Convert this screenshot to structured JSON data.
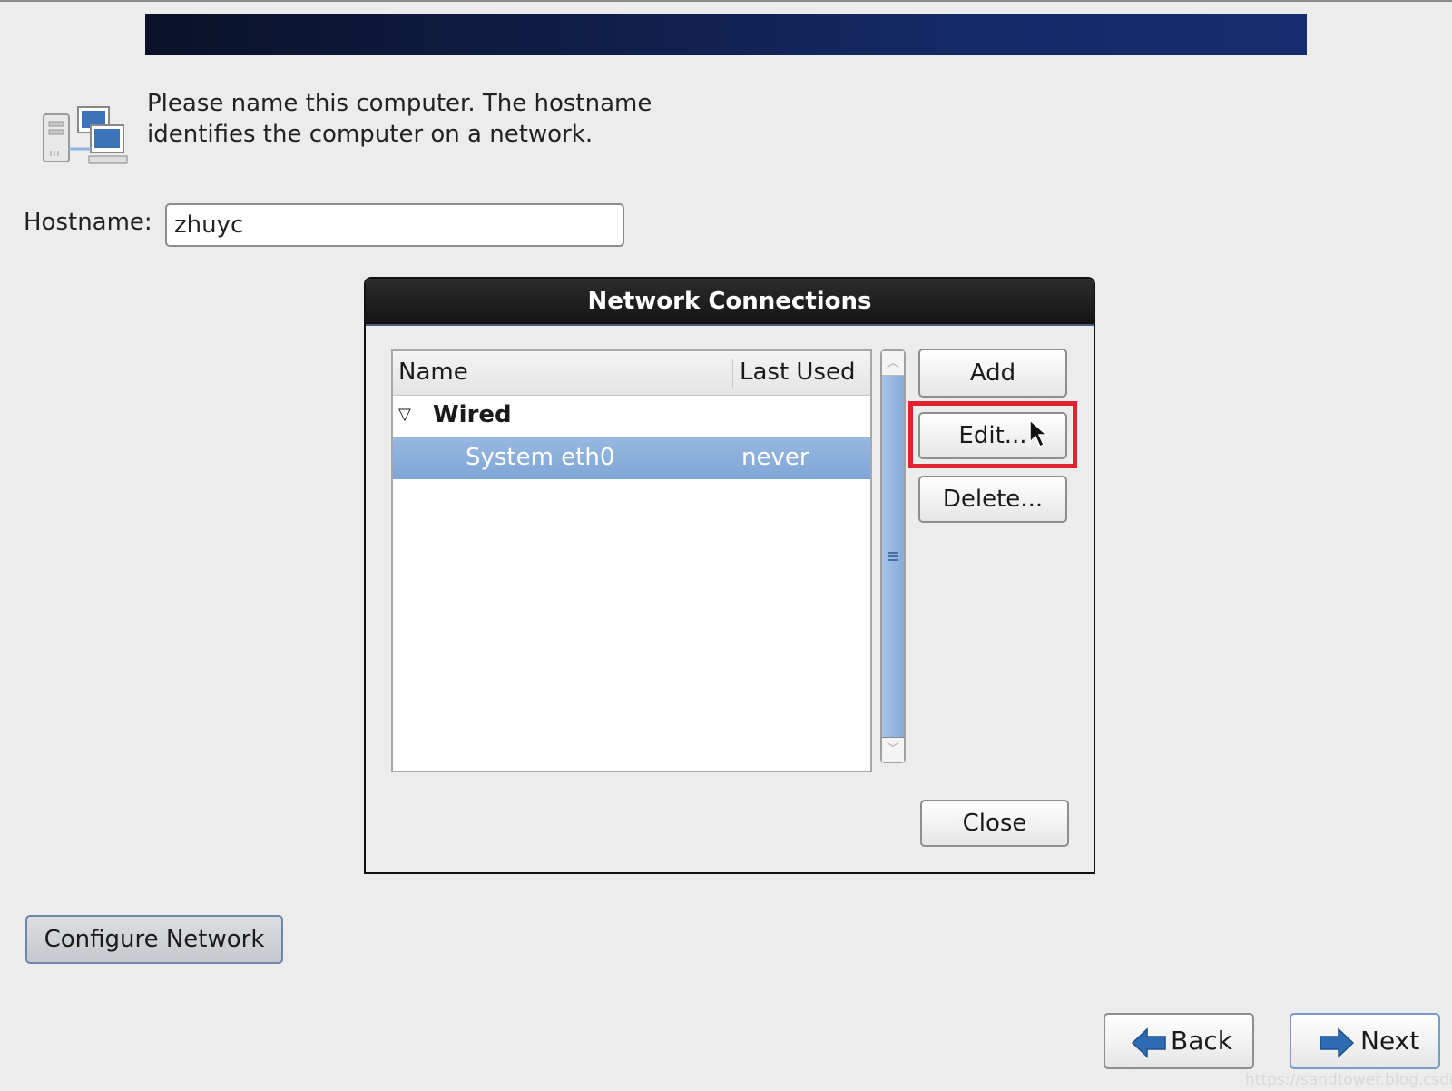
{
  "intro": {
    "description": "Please name this computer.  The hostname identifies the computer on a network.",
    "icon": "network-computers-icon"
  },
  "hostname": {
    "label": "Hostname:",
    "value": "zhuyc"
  },
  "dialog": {
    "title": "Network Connections",
    "columns": [
      "Name",
      "Last Used"
    ],
    "groups": [
      {
        "label": "Wired",
        "expanded": true,
        "items": [
          {
            "name": "System eth0",
            "last_used": "never",
            "selected": true
          }
        ]
      }
    ],
    "buttons": {
      "add": "Add",
      "edit": "Edit...",
      "delete": "Delete...",
      "close": "Close"
    },
    "highlight_color": "#e0222e",
    "selection_color": "#8fb0dc"
  },
  "configure_network": "Configure Network",
  "nav": {
    "back": "Back",
    "next": "Next"
  },
  "watermark": "https://sandtower.blog.csdn.net"
}
